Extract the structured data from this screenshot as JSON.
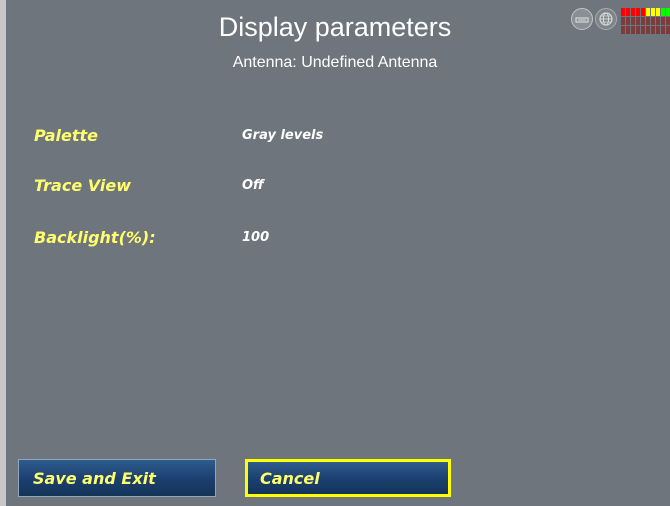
{
  "header": {
    "title": "Display parameters",
    "subtitle": "Antenna: Undefined Antenna"
  },
  "status": {
    "icons": [
      "lnb-icon",
      "satellite-globe-icon"
    ],
    "signal_meter": {
      "columns": 10,
      "lit_colors": [
        "#ff0000",
        "#ff0000",
        "#ff0000",
        "#ff0000",
        "#ff0000",
        "#ffff00",
        "#ffff00",
        "#ffff00",
        "#00ff00",
        "#00ff00"
      ],
      "unlit_color": "#7a3c3c"
    }
  },
  "parameters": [
    {
      "label": "Palette",
      "value": "Gray levels"
    },
    {
      "label": "Trace View",
      "value": "Off"
    },
    {
      "label": "Backlight(%):",
      "value": "100"
    }
  ],
  "buttons": {
    "save_exit": "Save and Exit",
    "cancel": "Cancel"
  },
  "colors": {
    "background": "#6e757c",
    "label": "#ffff6e",
    "focus": "#ffff00",
    "button": "#1b3f6e"
  }
}
